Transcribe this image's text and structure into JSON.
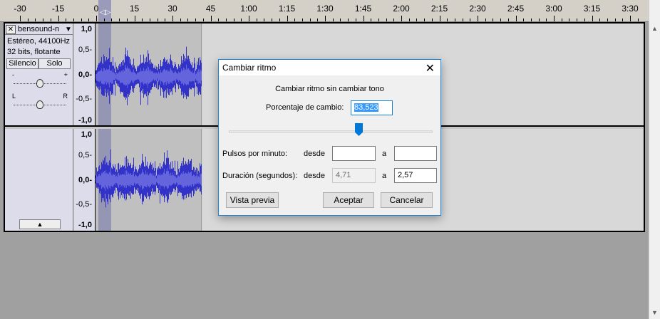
{
  "timeline": {
    "labels": [
      "-30",
      "-15",
      "0",
      "15",
      "30",
      "45",
      "1:00",
      "1:15",
      "1:30",
      "1:45",
      "2:00",
      "2:15",
      "2:30",
      "2:45",
      "3:00",
      "3:15",
      "3:30"
    ]
  },
  "track": {
    "name": "bensound-n",
    "info_line1": "Estéreo, 44100Hz",
    "info_line2": "32 bits, flotante",
    "mute_label": "Silencio",
    "solo_label": "Solo",
    "gain_minus": "-",
    "gain_plus": "+",
    "pan_left": "L",
    "pan_right": "R",
    "ruler_labels": [
      "1,0",
      "0,5-",
      "0,0-",
      "-0,5-",
      "-1,0"
    ]
  },
  "dialog": {
    "title": "Cambiar ritmo",
    "subtitle": "Cambiar ritmo sin cambiar tono",
    "percent_label": "Porcentaje de cambio:",
    "percent_value": "83,523",
    "slider_percent": 83.523,
    "bpm_label": "Pulsos por minuto:",
    "from_label": "desde",
    "to_label": "a",
    "bpm_from": "",
    "bpm_to": "",
    "duration_label": "Duración (segundos):",
    "duration_from": "4,71",
    "duration_to": "2,57",
    "preview_label": "Vista previa",
    "ok_label": "Aceptar",
    "cancel_label": "Cancelar"
  },
  "colors": {
    "waveform": "#3232c8",
    "selection": "#8a8ab0",
    "dialog_border": "#1883d7",
    "accent": "#0078d7"
  }
}
